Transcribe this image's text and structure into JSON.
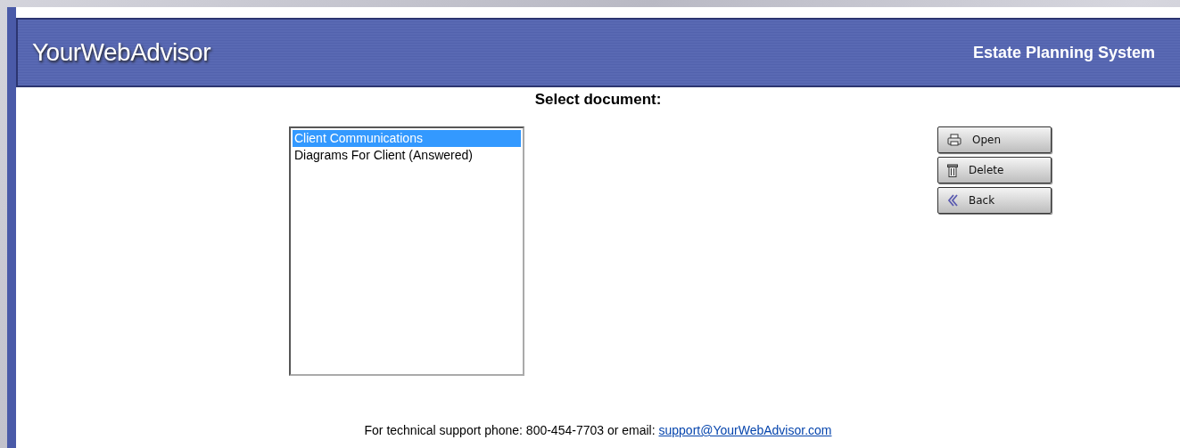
{
  "header": {
    "logo": "YourWebAdvisor",
    "system_name": "Estate Planning System"
  },
  "heading": "Select document:",
  "documents": [
    {
      "label": "Client Communications",
      "selected": true
    },
    {
      "label": "Diagrams For Client (Answered)",
      "selected": false
    }
  ],
  "buttons": [
    {
      "label": "Open",
      "kind": "open"
    },
    {
      "label": "Delete",
      "kind": "delete"
    },
    {
      "label": "Back",
      "kind": "back"
    }
  ],
  "footer": {
    "text": "For technical support phone: 800-454-7703 or email:",
    "email": "support@YourWebAdvisor.com"
  }
}
